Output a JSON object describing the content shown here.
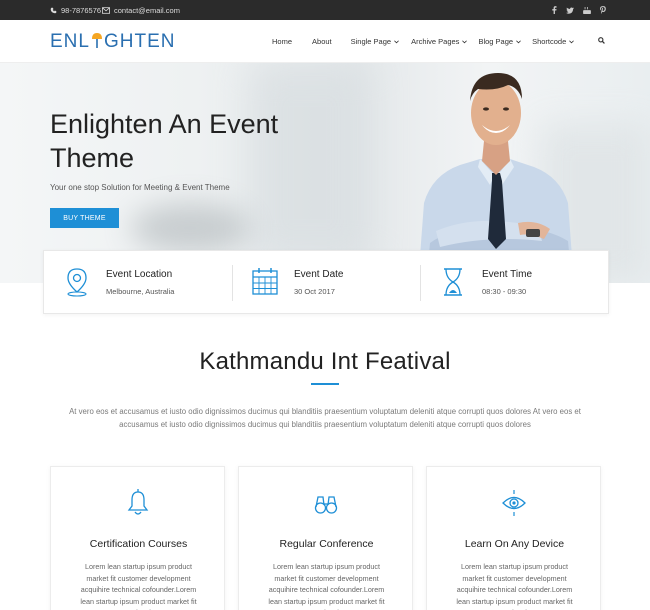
{
  "topbar": {
    "phone": "98-7876576",
    "email": "contact@email.com",
    "social_icons": [
      "facebook-icon",
      "twitter-icon",
      "youtube-icon",
      "pinterest-icon"
    ]
  },
  "brand": {
    "logo_left": "ENL",
    "logo_right": "GHTEN",
    "accent": "#1e8fd6",
    "logo_color": "#2a6fb0",
    "bulb_color": "#f5a623"
  },
  "nav": {
    "home": "Home",
    "about": "About",
    "single_page": "Single Page",
    "archive_pages": "Archive Pages",
    "blog_page": "Blog Page",
    "shortcode": "Shortcode"
  },
  "hero": {
    "title": "Enlighten An Event Theme",
    "subtitle": "Your one stop Solution for Meeting & Event Theme",
    "button": "BUY THEME"
  },
  "info": [
    {
      "icon": "location-pin-icon",
      "title": "Event Location",
      "value": "Melbourne, Australia"
    },
    {
      "icon": "calendar-icon",
      "title": "Event Date",
      "value": "30 Oct 2017"
    },
    {
      "icon": "hourglass-icon",
      "title": "Event Time",
      "value": "08:30 - 09:30"
    }
  ],
  "section": {
    "title": "Kathmandu Int Featival",
    "text_line1": "At vero eos et accusamus et iusto odio dignissimos ducimus qui blanditiis praesentium voluptatum deleniti atque corrupti quos dolores At vero eos et",
    "text_line2": "accusamus et iusto odio dignissimos ducimus qui blanditiis praesentium voluptatum deleniti atque corrupti quos dolores"
  },
  "cards": [
    {
      "icon": "bell-icon",
      "title": "Certification Courses",
      "text": "Lorem lean startup ipsum product market fit customer development acquihire technical cofounder.Lorem lean startup ipsum product market fit customer development"
    },
    {
      "icon": "binoculars-icon",
      "title": "Regular Conference",
      "text": "Lorem lean startup ipsum product market fit customer development acquihire technical cofounder.Lorem lean startup ipsum product market fit customer development"
    },
    {
      "icon": "eye-icon",
      "title": "Learn On Any Device",
      "text": "Lorem lean startup ipsum product market fit customer development acquihire technical cofounder.Lorem lean startup ipsum product market fit customer development"
    }
  ]
}
